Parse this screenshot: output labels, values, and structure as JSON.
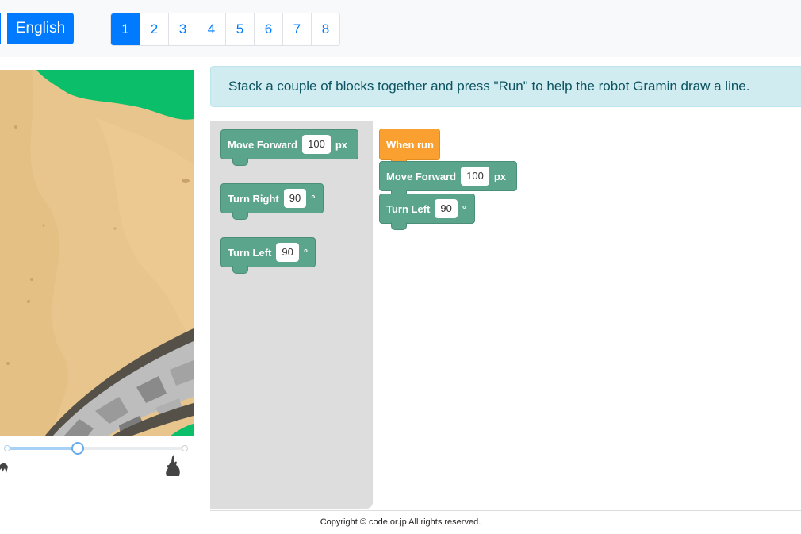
{
  "header": {
    "language_label": "English",
    "pages": [
      "1",
      "2",
      "3",
      "4",
      "5",
      "6",
      "7",
      "8"
    ],
    "active_page": "1"
  },
  "instruction": "Stack a couple of blocks together and press \"Run\" to help the robot Gramin draw a line.",
  "speed": {
    "level": 0.4
  },
  "toolbox": {
    "move_forward": {
      "label": "Move Forward",
      "value": "100",
      "unit": "px"
    },
    "turn_right": {
      "label": "Turn Right",
      "value": "90",
      "unit": "°"
    },
    "turn_left": {
      "label": "Turn Left",
      "value": "90",
      "unit": "°"
    }
  },
  "program": {
    "when_run": "When run",
    "move_forward": {
      "label": "Move Forward",
      "value": "100",
      "unit": "px"
    },
    "turn_left": {
      "label": "Turn Left",
      "value": "90",
      "unit": "°"
    }
  },
  "footer": "Copyright © code.or.jp All rights reserved.",
  "colors": {
    "primary": "#007bff",
    "block_green": "#5ba58c",
    "event_orange": "#f9a031",
    "sand": "#e8c58c",
    "grass": "#0bbf6a"
  }
}
